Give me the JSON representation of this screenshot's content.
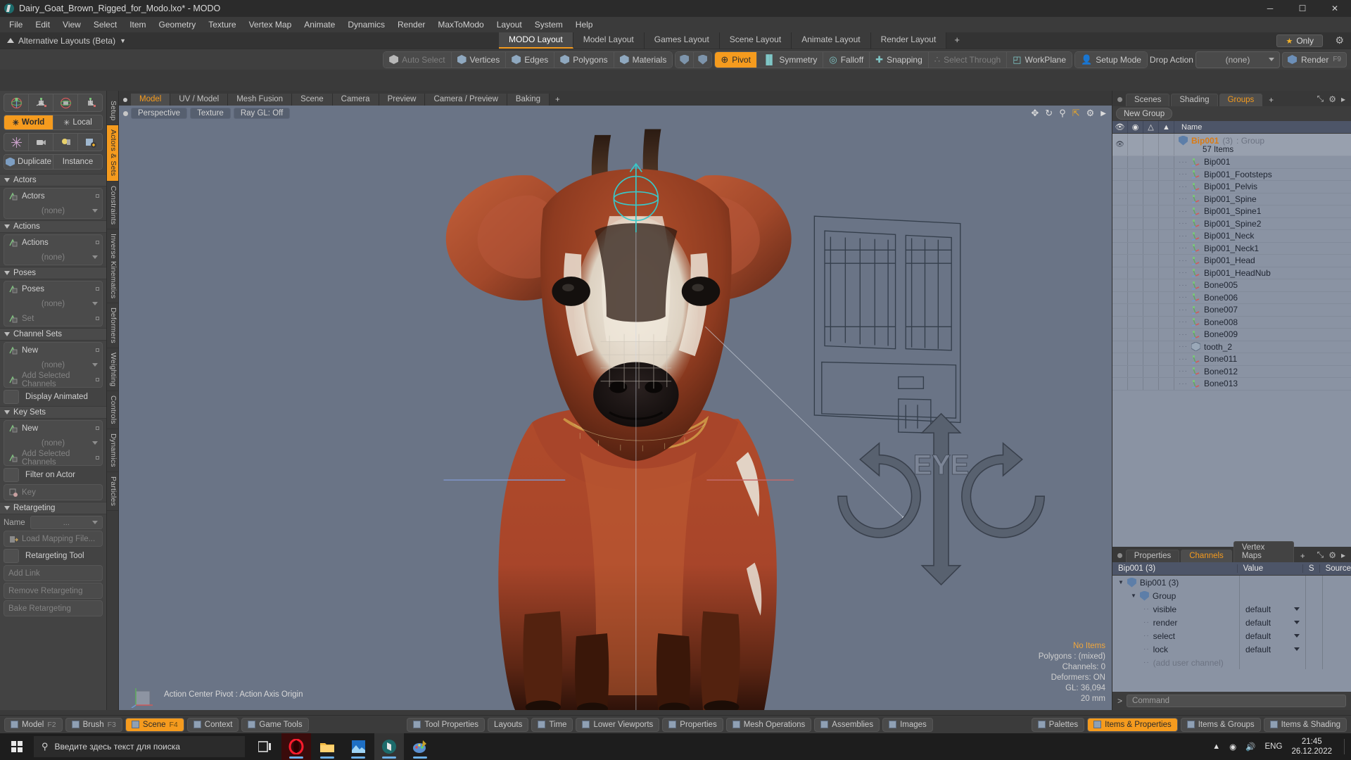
{
  "window": {
    "title": "Dairy_Goat_Brown_Rigged_for_Modo.lxo* - MODO",
    "minimize": "─",
    "maximize": "☐",
    "close": "✕"
  },
  "menubar": [
    "File",
    "Edit",
    "View",
    "Select",
    "Item",
    "Geometry",
    "Texture",
    "Vertex Map",
    "Animate",
    "Dynamics",
    "Render",
    "MaxToModo",
    "Layout",
    "System",
    "Help"
  ],
  "layoutrow": {
    "alt_layouts": "Alternative Layouts (Beta)",
    "tabs": [
      {
        "label": "MODO Layout",
        "selected": true
      },
      {
        "label": "Model Layout",
        "selected": false
      },
      {
        "label": "Games Layout",
        "selected": false
      },
      {
        "label": "Scene Layout",
        "selected": false
      },
      {
        "label": "Animate Layout",
        "selected": false
      },
      {
        "label": "Render Layout",
        "selected": false
      }
    ],
    "add_tab": "+",
    "only_label": "Only",
    "only_star": "★"
  },
  "toolbar": {
    "selection_modes": [
      {
        "label": "Auto Select",
        "state": "dim",
        "icon": "cube-icon"
      },
      {
        "label": "Vertices",
        "state": "normal",
        "icon": "cube-icon"
      },
      {
        "label": "Edges",
        "state": "normal",
        "icon": "cube-icon"
      },
      {
        "label": "Polygons",
        "state": "normal",
        "icon": "cube-icon"
      },
      {
        "label": "Materials",
        "state": "normal",
        "icon": "cube-icon"
      }
    ],
    "action_center": [
      {
        "label": "Pivot",
        "state": "on",
        "icon": "pivot-icon"
      },
      {
        "label": "Symmetry",
        "state": "normal",
        "icon": "symmetry-icon"
      },
      {
        "label": "Falloff",
        "state": "normal",
        "icon": "falloff-icon"
      },
      {
        "label": "Snapping",
        "state": "normal",
        "icon": "snapping-icon"
      },
      {
        "label": "Select Through",
        "state": "dim",
        "icon": "select-through-icon"
      },
      {
        "label": "WorkPlane",
        "state": "normal",
        "icon": "workplane-icon"
      }
    ],
    "setup_mode": "Setup Mode",
    "drop_action_label": "Drop Action",
    "drop_action_value": "(none)",
    "render_label": "Render",
    "render_key": "F9"
  },
  "leftpanel": {
    "transform_mode": [
      {
        "label": "World",
        "selected": true
      },
      {
        "label": "Local",
        "selected": false
      }
    ],
    "duplicate": "Duplicate",
    "instance": "Instance",
    "sections": [
      {
        "title": "Actors",
        "rows": [
          {
            "label": "Actors",
            "type": "item",
            "dim": false
          },
          {
            "label": "(none)",
            "type": "dropdown",
            "dim": true
          }
        ]
      },
      {
        "title": "Actions",
        "rows": [
          {
            "label": "Actions",
            "type": "item",
            "dim": false
          },
          {
            "label": "(none)",
            "type": "dropdown",
            "dim": true
          }
        ]
      },
      {
        "title": "Poses",
        "rows": [
          {
            "label": "Poses",
            "type": "item",
            "dim": false
          },
          {
            "label": "(none)",
            "type": "dropdown",
            "dim": true
          },
          {
            "label": "Set",
            "type": "item",
            "dim": true
          }
        ]
      },
      {
        "title": "Channel Sets",
        "rows": [
          {
            "label": "New",
            "type": "item",
            "dim": false
          },
          {
            "label": "(none)",
            "type": "dropdown",
            "dim": true
          },
          {
            "label": "Add Selected Channels",
            "type": "item",
            "dim": true
          }
        ],
        "checkbox": "Display Animated"
      },
      {
        "title": "Key Sets",
        "rows": [
          {
            "label": "New",
            "type": "item",
            "dim": false
          },
          {
            "label": "(none)",
            "type": "dropdown",
            "dim": true
          },
          {
            "label": "Add Selected Channels",
            "type": "item",
            "dim": true
          }
        ],
        "checkbox": "Filter on Actor",
        "extra": "Key"
      }
    ],
    "retargeting": {
      "title": "Retargeting",
      "name_label": "Name",
      "name_value": "...",
      "load_mapping": "Load Mapping File...",
      "tool_checkbox": "Retargeting Tool",
      "add_link": "Add Link",
      "remove": "Remove Retargeting",
      "bake": "Bake Retargeting"
    },
    "vtabs": [
      {
        "label": "Setup",
        "selected": false
      },
      {
        "label": "Actors & Sets",
        "selected": true
      },
      {
        "label": "Constraints",
        "selected": false
      },
      {
        "label": "Inverse Kinematics",
        "selected": false
      },
      {
        "label": "Deformers",
        "selected": false
      },
      {
        "label": "Weighting",
        "selected": false
      },
      {
        "label": "Controls",
        "selected": false
      },
      {
        "label": "Dynamics",
        "selected": false
      },
      {
        "label": "Particles",
        "selected": false
      }
    ]
  },
  "viewport": {
    "tabs": [
      {
        "label": "Model",
        "selected": true
      },
      {
        "label": "UV / Model",
        "selected": false
      },
      {
        "label": "Mesh Fusion",
        "selected": false
      },
      {
        "label": "Scene",
        "selected": false
      },
      {
        "label": "Camera",
        "selected": false
      },
      {
        "label": "Preview",
        "selected": false
      },
      {
        "label": "Camera / Preview",
        "selected": false
      },
      {
        "label": "Baking",
        "selected": false
      }
    ],
    "add_tab": "+",
    "chips": [
      "Perspective",
      "Texture",
      "Ray GL: Off"
    ],
    "action_center_text": "Action Center Pivot : Action Axis Origin",
    "stats": {
      "items": "No Items",
      "polygons": "Polygons : (mixed)",
      "channels": "Channels: 0",
      "deformers": "Deformers: ON",
      "gl": "GL: 36,094",
      "units": "20 mm"
    },
    "icons": [
      "move-icon",
      "rotate-icon",
      "zoom-icon",
      "fit-icon",
      "gear-icon",
      "chevron-right-icon"
    ]
  },
  "rightpanel": {
    "top_tabs": [
      {
        "label": "Scenes",
        "selected": false
      },
      {
        "label": "Shading",
        "selected": false
      },
      {
        "label": "Groups",
        "selected": true
      }
    ],
    "add_tab": "+",
    "new_group": "New Group",
    "list_header": {
      "name": "Name"
    },
    "group_row": {
      "name": "Bip001",
      "count": "(3)",
      "type": ": Group",
      "subtitle": "57 Items"
    },
    "items": [
      {
        "label": "Bip001",
        "icon": "bone-icon"
      },
      {
        "label": "Bip001_Footsteps",
        "icon": "bone-icon"
      },
      {
        "label": "Bip001_Pelvis",
        "icon": "bone-icon"
      },
      {
        "label": "Bip001_Spine",
        "icon": "bone-icon"
      },
      {
        "label": "Bip001_Spine1",
        "icon": "bone-icon"
      },
      {
        "label": "Bip001_Spine2",
        "icon": "bone-icon"
      },
      {
        "label": "Bip001_Neck",
        "icon": "bone-icon"
      },
      {
        "label": "Bip001_Neck1",
        "icon": "bone-icon"
      },
      {
        "label": "Bip001_Head",
        "icon": "bone-icon"
      },
      {
        "label": "Bip001_HeadNub",
        "icon": "bone-icon"
      },
      {
        "label": "Bone005",
        "icon": "bone-icon"
      },
      {
        "label": "Bone006",
        "icon": "bone-icon"
      },
      {
        "label": "Bone007",
        "icon": "bone-icon"
      },
      {
        "label": "Bone008",
        "icon": "bone-icon"
      },
      {
        "label": "Bone009",
        "icon": "bone-icon"
      },
      {
        "label": "tooth_2",
        "icon": "mesh-icon"
      },
      {
        "label": "Bone011",
        "icon": "bone-icon"
      },
      {
        "label": "Bone012",
        "icon": "bone-icon"
      },
      {
        "label": "Bone013",
        "icon": "bone-icon"
      }
    ],
    "bottom_tabs": [
      {
        "label": "Properties",
        "selected": false
      },
      {
        "label": "Channels",
        "selected": true
      },
      {
        "label": "Vertex Maps",
        "selected": false
      }
    ],
    "channel_header": {
      "name": "Bip001 (3)",
      "value": "Value",
      "s": "S",
      "source": "Source"
    },
    "channel_tree": [
      {
        "label": "Bip001 (3)",
        "indent": 0,
        "type": "group",
        "value": ""
      },
      {
        "label": "Group",
        "indent": 1,
        "type": "group",
        "value": ""
      },
      {
        "label": "visible",
        "indent": 2,
        "type": "channel",
        "value": "default"
      },
      {
        "label": "render",
        "indent": 2,
        "type": "channel",
        "value": "default"
      },
      {
        "label": "select",
        "indent": 2,
        "type": "channel",
        "value": "default"
      },
      {
        "label": "lock",
        "indent": 2,
        "type": "channel",
        "value": "default"
      },
      {
        "label": "(add user channel)",
        "indent": 2,
        "type": "add",
        "value": ""
      }
    ],
    "command_placeholder": "Command"
  },
  "statusbar": {
    "left": [
      {
        "label": "Model",
        "key": "F2",
        "on": false
      },
      {
        "label": "Brush",
        "key": "F3",
        "on": false
      },
      {
        "label": "Scene",
        "key": "F4",
        "on": true
      },
      {
        "label": "Context",
        "key": "",
        "on": false
      },
      {
        "label": "Game Tools",
        "key": "",
        "on": false
      }
    ],
    "center": [
      {
        "label": "Tool Properties"
      },
      {
        "label": "Layouts"
      },
      {
        "label": "Time"
      },
      {
        "label": "Lower Viewports"
      },
      {
        "label": "Properties"
      },
      {
        "label": "Mesh Operations"
      },
      {
        "label": "Assemblies"
      },
      {
        "label": "Images"
      }
    ],
    "right": [
      {
        "label": "Palettes",
        "on": false
      },
      {
        "label": "Items & Properties",
        "on": true
      },
      {
        "label": "Items & Groups",
        "on": false
      },
      {
        "label": "Items & Shading",
        "on": false
      }
    ]
  },
  "taskbar": {
    "search_placeholder": "Введите здесь текст для поиска",
    "apps": [
      {
        "name": "task-view-icon"
      },
      {
        "name": "opera-icon"
      },
      {
        "name": "file-explorer-icon"
      },
      {
        "name": "photos-icon"
      },
      {
        "name": "modo-icon"
      },
      {
        "name": "paint-icon"
      }
    ],
    "language": "ENG",
    "time": "21:45",
    "date": "26.12.2022"
  }
}
